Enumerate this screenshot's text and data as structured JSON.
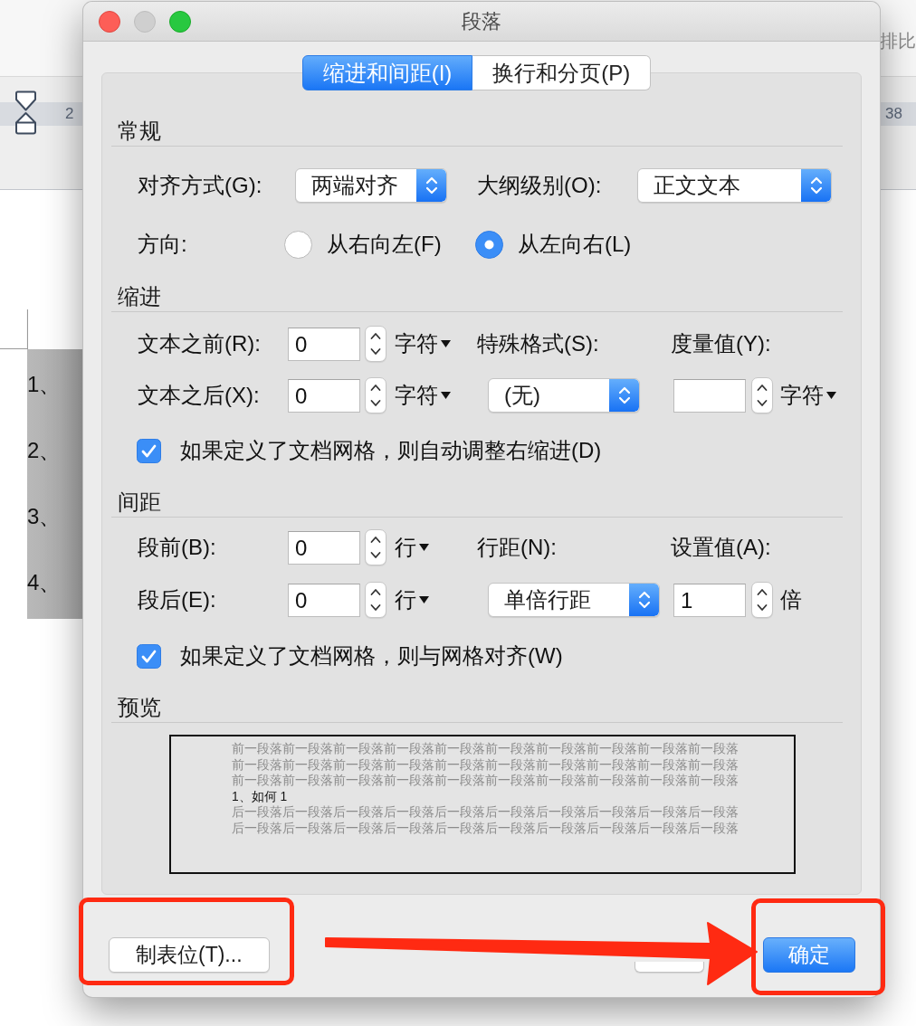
{
  "background": {
    "toolbar_text": "排比",
    "ruler_labels": [
      "2",
      "38"
    ],
    "list_items": [
      "1、",
      "2、",
      "3、",
      "4、"
    ]
  },
  "window": {
    "title": "段落",
    "controls": [
      {
        "kind": "close",
        "disabled": false
      },
      {
        "kind": "minimize",
        "disabled": true
      },
      {
        "kind": "zoom",
        "disabled": false
      }
    ]
  },
  "tabs": [
    {
      "label": "缩进和间距(I)",
      "selected": true
    },
    {
      "label": "换行和分页(P)",
      "selected": false
    }
  ],
  "general": {
    "heading": "常规",
    "alignment": {
      "label": "对齐方式(G):",
      "value": "两端对齐"
    },
    "outline_level": {
      "label": "大纲级别(O):",
      "value": "正文文本"
    },
    "direction": {
      "label": "方向:",
      "options": [
        {
          "label": "从右向左(F)",
          "selected": false
        },
        {
          "label": "从左向右(L)",
          "selected": true
        }
      ]
    }
  },
  "indent": {
    "heading": "缩进",
    "before": {
      "label": "文本之前(R):",
      "value": "0",
      "unit": {
        "label": "字符",
        "kind": "menu"
      }
    },
    "after": {
      "label": "文本之后(X):",
      "value": "0",
      "unit": {
        "label": "字符",
        "kind": "menu"
      }
    },
    "special": {
      "label": "特殊格式(S):",
      "value": "(无)"
    },
    "by": {
      "label": "度量值(Y):",
      "unit": {
        "label": "字符",
        "kind": "menu"
      }
    },
    "auto_adjust": {
      "label": "如果定义了文档网格，则自动调整右缩进(D)",
      "checked": true
    }
  },
  "spacing": {
    "heading": "间距",
    "before": {
      "label": "段前(B):",
      "value": "0",
      "unit": {
        "label": "行",
        "kind": "menu"
      }
    },
    "after": {
      "label": "段后(E):",
      "value": "0",
      "unit": {
        "label": "行",
        "kind": "menu"
      }
    },
    "line_spacing": {
      "label": "行距(N):",
      "value": "单倍行距"
    },
    "at": {
      "label": "设置值(A):",
      "value": "1",
      "unit": {
        "label": "倍",
        "kind": "text"
      }
    },
    "snap_to_grid": {
      "label": "如果定义了文档网格，则与网格对齐(W)",
      "checked": true
    }
  },
  "preview": {
    "heading": "预览",
    "lines": [
      {
        "kind": "previous",
        "text": "前一段落前一段落前一段落前一段落前一段落前一段落前一段落前一段落前一段落前一段落"
      },
      {
        "kind": "previous",
        "text": "前一段落前一段落前一段落前一段落前一段落前一段落前一段落前一段落前一段落前一段落"
      },
      {
        "kind": "previous",
        "text": "前一段落前一段落前一段落前一段落前一段落前一段落前一段落前一段落前一段落前一段落"
      },
      {
        "kind": "current",
        "text": "1、如何 1"
      },
      {
        "kind": "following",
        "text": "后一段落后一段落后一段落后一段落后一段落后一段落后一段落后一段落后一段落后一段落"
      },
      {
        "kind": "following",
        "text": "后一段落后一段落后一段落后一段落后一段落后一段落后一段落后一段落后一段落后一段落"
      }
    ]
  },
  "buttons": [
    {
      "kind": "plain",
      "label": "制表位(T)..."
    },
    {
      "kind": "covered"
    },
    {
      "kind": "default",
      "label": "确定"
    }
  ],
  "annotations": [
    {
      "kind": "frame"
    },
    {
      "kind": "arrow"
    },
    {
      "kind": "frame"
    }
  ]
}
